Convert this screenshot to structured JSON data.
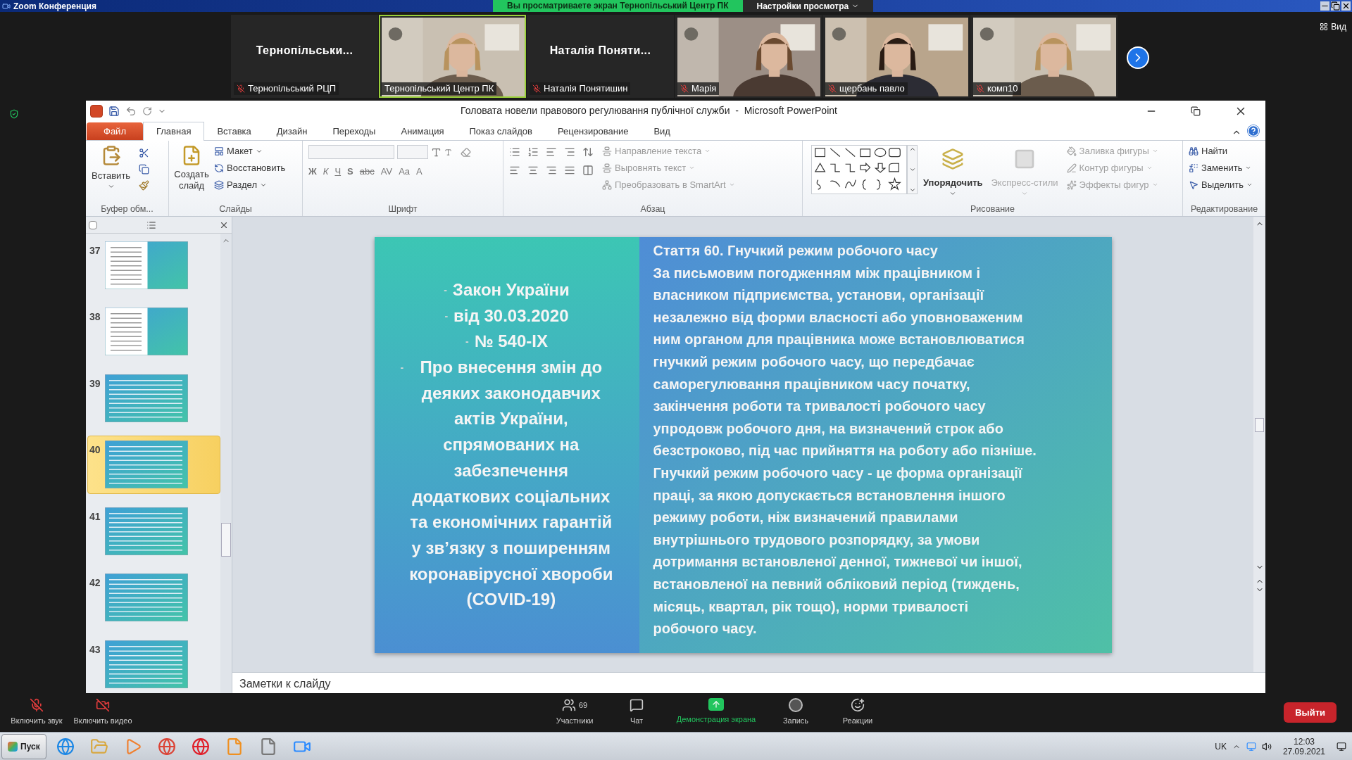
{
  "zoom_window": {
    "title": "Zoom Конференция",
    "banner": "Вы просматриваете экран Тернопільський Центр ПК",
    "view_settings": "Настройки просмотра",
    "view_button": "Вид"
  },
  "participants": [
    {
      "kind": "name",
      "display": "Тернопільськи...",
      "label": "Тернопільський РЦП",
      "muted": true,
      "active": false
    },
    {
      "kind": "picture",
      "label": "Тернопільський Центр ПК",
      "muted": false,
      "active": true
    },
    {
      "kind": "name",
      "display": "Наталія Поняти...",
      "label": "Наталія Понятишин",
      "muted": true,
      "active": false
    },
    {
      "kind": "picture",
      "label": "Марія",
      "muted": true,
      "active": false
    },
    {
      "kind": "picture",
      "label": "щербань павло",
      "muted": true,
      "active": false
    },
    {
      "kind": "picture",
      "label": "комп10",
      "muted": true,
      "active": false
    }
  ],
  "powerpoint": {
    "title": "Головата новели правового регулювання публічної служби  -  Microsoft PowerPoint",
    "tabs": [
      {
        "label": "Файл",
        "kind": "file",
        "selected": false
      },
      {
        "label": "Главная",
        "kind": "tab",
        "selected": true
      },
      {
        "label": "Вставка",
        "kind": "tab",
        "selected": false
      },
      {
        "label": "Дизайн",
        "kind": "tab",
        "selected": false
      },
      {
        "label": "Переходы",
        "kind": "tab",
        "selected": false
      },
      {
        "label": "Анимация",
        "kind": "tab",
        "selected": false
      },
      {
        "label": "Показ слайдов",
        "kind": "tab",
        "selected": false
      },
      {
        "label": "Рецензирование",
        "kind": "tab",
        "selected": false
      },
      {
        "label": "Вид",
        "kind": "tab",
        "selected": false
      }
    ],
    "ribbon": {
      "clipboard": {
        "label": "Буфер обм...",
        "paste": "Вставить"
      },
      "slides": {
        "label": "Слайды",
        "new_slide": "Создать слайд",
        "items": [
          {
            "label": "Макет",
            "dropdown": true
          },
          {
            "label": "Восстановить",
            "dropdown": false
          },
          {
            "label": "Раздел",
            "dropdown": true
          }
        ]
      },
      "font": {
        "label": "Шрифт",
        "format_buttons": [
          "Ж",
          "К",
          "Ч",
          "S",
          "abc",
          "AV",
          "Aa",
          "A"
        ]
      },
      "paragraph": {
        "label": "Абзац",
        "items": [
          {
            "label": "Направление текста",
            "disabled": true
          },
          {
            "label": "Выровнять текст",
            "disabled": true
          },
          {
            "label": "Преобразовать в SmartArt",
            "disabled": true
          }
        ]
      },
      "drawing": {
        "label": "Рисование",
        "arrange": {
          "label": "Упорядочить",
          "disabled": false
        },
        "quick_styles": {
          "label": "Экспресс-стили",
          "disabled": true
        },
        "items": [
          {
            "label": "Заливка фигуры",
            "disabled": true
          },
          {
            "label": "Контур фигуры",
            "disabled": true
          },
          {
            "label": "Эффекты фигур",
            "disabled": true
          }
        ]
      },
      "editing": {
        "label": "Редактирование",
        "items": [
          {
            "label": "Найти",
            "dropdown": false
          },
          {
            "label": "Заменить",
            "dropdown": true
          },
          {
            "label": "Выделить",
            "dropdown": true
          }
        ]
      }
    },
    "thumbnails": [
      {
        "number": "37",
        "selected": false
      },
      {
        "number": "38",
        "selected": false
      },
      {
        "number": "39",
        "selected": false
      },
      {
        "number": "40",
        "selected": true
      },
      {
        "number": "41",
        "selected": false
      },
      {
        "number": "42",
        "selected": false
      },
      {
        "number": "43",
        "selected": false
      }
    ],
    "slide": {
      "left": [
        {
          "marker": "-",
          "lines": [
            "Закон України"
          ]
        },
        {
          "marker": "-",
          "lines": [
            "від 30.03.2020"
          ]
        },
        {
          "marker": "-",
          "lines": [
            "№ 540-ІХ"
          ]
        },
        {
          "marker": "-",
          "lines": [
            "Про внесення змін до",
            "деяких законодавчих",
            "актів України,",
            "спрямованих на",
            "забезпечення",
            "додаткових соціальних",
            "та економічних гарантій",
            "у зв’язку з поширенням",
            "коронавірусної хвороби",
            "(COVID-19)"
          ]
        }
      ],
      "right_lines": [
        "Стаття 60. Гнучкий режим робочого часу",
        "За письмовим погодженням між працівником і",
        "власником підприємства, установи, організації",
        "незалежно від форми власності або уповноваженим",
        "ним органом для працівника може встановлюватися",
        "гнучкий режим робочого часу, що передбачає",
        "саморегулювання працівником часу початку,",
        "закінчення роботи та тривалості робочого часу",
        "упродовж робочого дня, на визначений строк або",
        "безстроково, під час прийняття на роботу або пізніше.",
        "Гнучкий режим робочого часу - це форма організації",
        "праці, за якою допускається встановлення іншого",
        "режиму роботи, ніж визначений правилами",
        "внутрішнього трудового розпорядку, за умови",
        "дотримання встановленої денної, тижневої чи іншої,",
        "встановленої на певний обліковий період (тиждень,",
        "місяць, квартал, рік тощо), норми тривалості",
        "робочого часу."
      ]
    },
    "notes_placeholder": "Заметки к слайду"
  },
  "zoom_toolbar": {
    "audio": "Включить звук",
    "video": "Включить видео",
    "participants": {
      "label": "Участники",
      "count": "69"
    },
    "chat": "Чат",
    "share": "Демонстрация экрана",
    "record": "Запись",
    "reactions": "Реакции",
    "leave": "Выйти"
  },
  "taskbar": {
    "start": "Пуск",
    "language": "UK",
    "time": "12:03",
    "date": "27.09.2021"
  }
}
